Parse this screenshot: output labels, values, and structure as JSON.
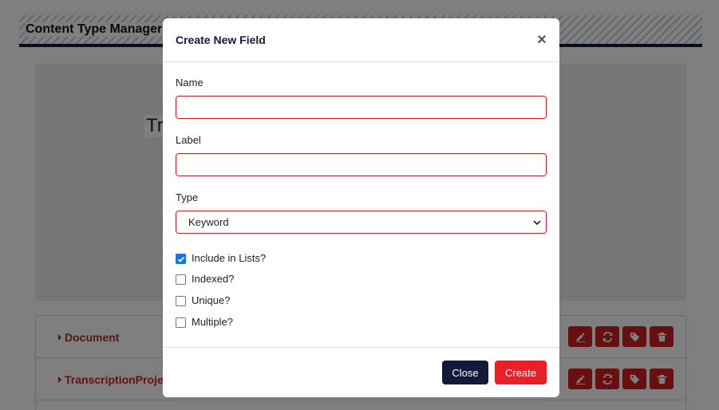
{
  "background": {
    "page_title": "Content Type Manager",
    "hero_title": "Tr",
    "content_types": [
      {
        "name": "Document"
      },
      {
        "name": "TranscriptionProje"
      }
    ],
    "row_actions": [
      "edit-icon",
      "sync-icon",
      "tag-icon",
      "trash-icon"
    ]
  },
  "modal": {
    "title": "Create New Field",
    "close_glyph": "×",
    "fields": {
      "name_label": "Name",
      "name_value": "",
      "label_label": "Label",
      "label_value": "",
      "type_label": "Type",
      "type_selected": "Keyword"
    },
    "checkboxes": [
      {
        "label": "Include in Lists?",
        "checked": true
      },
      {
        "label": "Indexed?",
        "checked": false
      },
      {
        "label": "Unique?",
        "checked": false
      },
      {
        "label": "Multiple?",
        "checked": false
      }
    ],
    "buttons": {
      "close_label": "Close",
      "create_label": "Create"
    }
  },
  "colors": {
    "accent_red": "#e52229",
    "navy": "#111a3a",
    "checkbox_blue": "#1a73e8"
  }
}
